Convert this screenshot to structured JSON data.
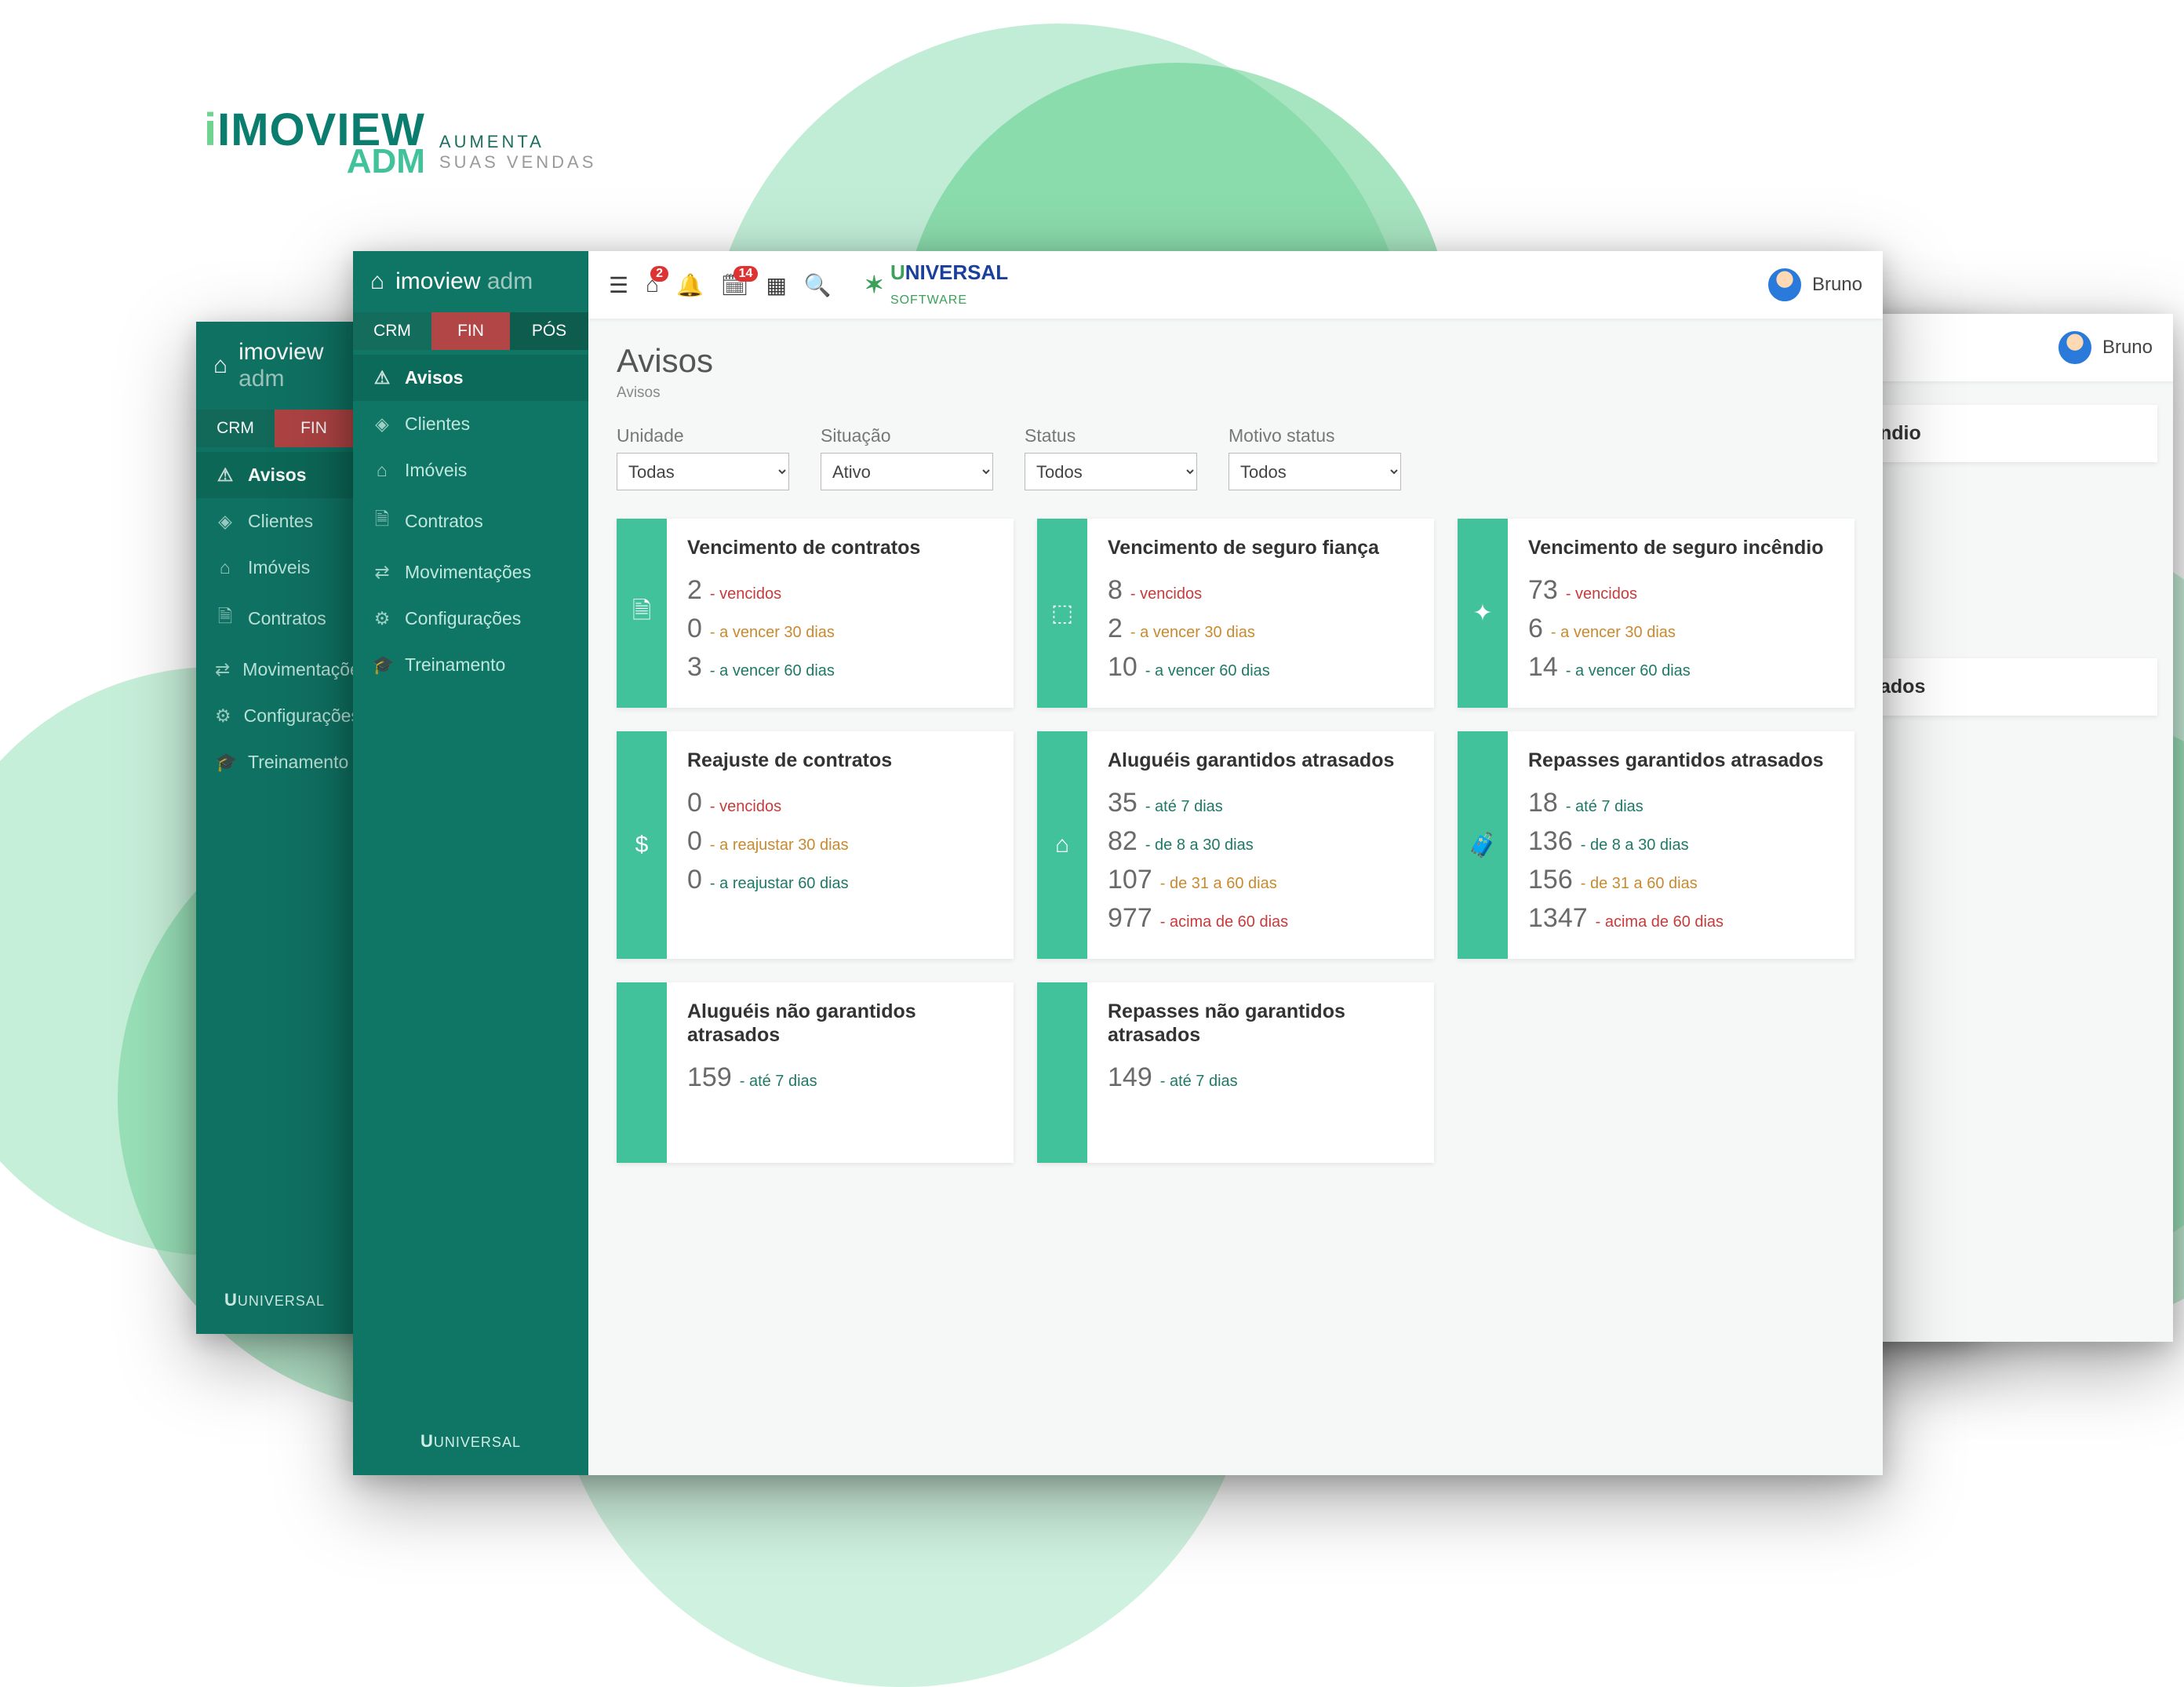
{
  "brand": {
    "name1": "IMOVIEW",
    "name2": "ADM",
    "tag1": "AUMENTA",
    "tag2": "SUAS VENDAS"
  },
  "topbar": {
    "logo_big": "NIVERSAL",
    "logo_small": "SOFTWARE",
    "badge_home": "2",
    "badge_cal": "14",
    "user": "Bruno"
  },
  "sidebar": {
    "title1": "imoview",
    "title2": "adm",
    "tabs": {
      "crm": "CRM",
      "fin": "FIN",
      "pos": "PÓS"
    },
    "items": [
      {
        "icon": "⚠",
        "label": "Avisos",
        "active": true
      },
      {
        "icon": "◈",
        "label": "Clientes"
      },
      {
        "icon": "⌂",
        "label": "Imóveis"
      },
      {
        "icon": "🗎",
        "label": "Contratos"
      },
      {
        "icon": "⇄",
        "label": "Movimentações"
      },
      {
        "icon": "⚙",
        "label": "Configurações"
      },
      {
        "icon": "🎓",
        "label": "Treinamento"
      }
    ],
    "footer": "UNIVERSAL"
  },
  "page": {
    "title": "Avisos",
    "breadcrumb": "Avisos"
  },
  "filters": [
    {
      "label": "Unidade",
      "value": "Todas"
    },
    {
      "label": "Situação",
      "value": "Ativo"
    },
    {
      "label": "Status",
      "value": "Todos"
    },
    {
      "label": "Motivo status",
      "value": "Todos"
    }
  ],
  "cards": [
    {
      "icon": "🗎",
      "title": "Vencimento de contratos",
      "rows": [
        {
          "n": "2",
          "l": "- vencidos",
          "c": "red"
        },
        {
          "n": "0",
          "l": "- a vencer 30 dias",
          "c": "orange"
        },
        {
          "n": "3",
          "l": "- a vencer 60 dias",
          "c": "teal"
        }
      ]
    },
    {
      "icon": "⬚",
      "title": "Vencimento de seguro fiança",
      "rows": [
        {
          "n": "8",
          "l": "- vencidos",
          "c": "red"
        },
        {
          "n": "2",
          "l": "- a vencer 30 dias",
          "c": "orange"
        },
        {
          "n": "10",
          "l": "- a vencer 60 dias",
          "c": "teal"
        }
      ]
    },
    {
      "icon": "✦",
      "title": "Vencimento de seguro incêndio",
      "rows": [
        {
          "n": "73",
          "l": "- vencidos",
          "c": "red"
        },
        {
          "n": "6",
          "l": "- a vencer 30 dias",
          "c": "orange"
        },
        {
          "n": "14",
          "l": "- a vencer 60 dias",
          "c": "teal"
        }
      ]
    },
    {
      "icon": "$",
      "title": "Reajuste de contratos",
      "rows": [
        {
          "n": "0",
          "l": "- vencidos",
          "c": "red"
        },
        {
          "n": "0",
          "l": "- a reajustar 30 dias",
          "c": "orange"
        },
        {
          "n": "0",
          "l": "- a reajustar 60 dias",
          "c": "teal"
        }
      ]
    },
    {
      "icon": "⌂",
      "title": "Aluguéis garantidos atrasados",
      "rows": [
        {
          "n": "35",
          "l": "- até 7 dias",
          "c": "teal"
        },
        {
          "n": "82",
          "l": "- de 8 a 30 dias",
          "c": "teal"
        },
        {
          "n": "107",
          "l": "- de 31 a 60 dias",
          "c": "orange"
        },
        {
          "n": "977",
          "l": "- acima de 60 dias",
          "c": "red"
        }
      ]
    },
    {
      "icon": "🧳",
      "title": "Repasses garantidos atrasados",
      "rows": [
        {
          "n": "18",
          "l": "- até 7 dias",
          "c": "teal"
        },
        {
          "n": "136",
          "l": "- de 8 a 30 dias",
          "c": "teal"
        },
        {
          "n": "156",
          "l": "- de 31 a 60 dias",
          "c": "orange"
        },
        {
          "n": "1347",
          "l": "- acima de 60 dias",
          "c": "red"
        }
      ]
    },
    {
      "icon": "",
      "title": "Aluguéis não garantidos atrasados",
      "rows": [
        {
          "n": "159",
          "l": "- até 7 dias",
          "c": "teal"
        }
      ]
    },
    {
      "icon": "",
      "title": "Repasses não garantidos atrasados",
      "rows": [
        {
          "n": "149",
          "l": "- até 7 dias",
          "c": "teal"
        }
      ]
    }
  ],
  "side_frags": [
    "ndio",
    "ados"
  ]
}
